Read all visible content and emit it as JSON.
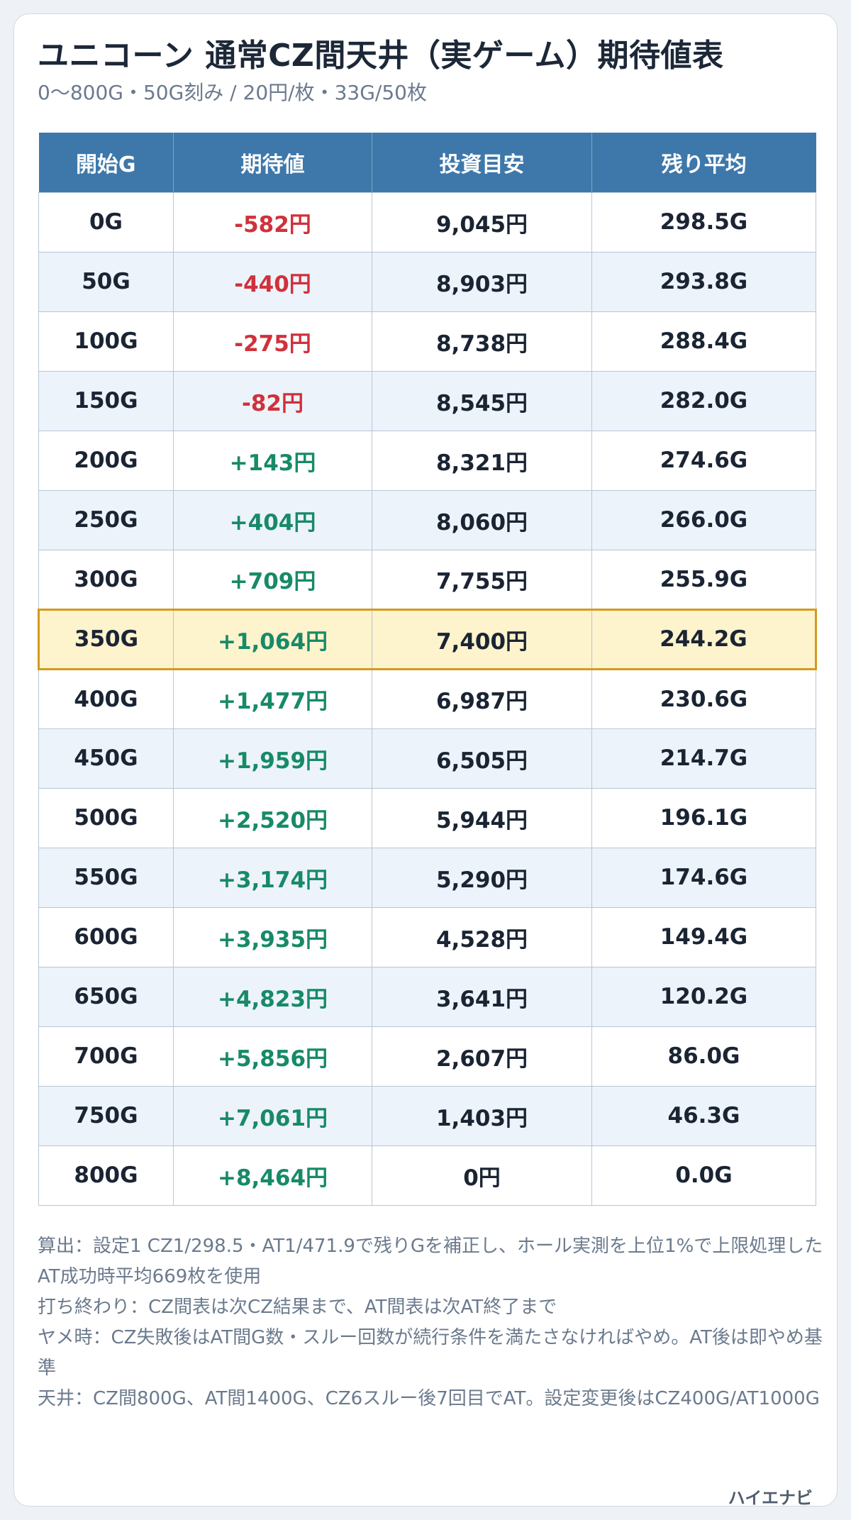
{
  "title": "ユニコーン 通常CZ間天井（実ゲーム）期待値表",
  "subtitle": "0〜800G・50G刻み / 20円/枚・33G/50枚",
  "table": {
    "headers": [
      "開始G",
      "期待値",
      "投資目安",
      "残り平均"
    ],
    "highlight_row": 7,
    "rows": [
      {
        "start": "0G",
        "ev": "-582円",
        "sign": "neg",
        "invest": "9,045円",
        "remain": "298.5G"
      },
      {
        "start": "50G",
        "ev": "-440円",
        "sign": "neg",
        "invest": "8,903円",
        "remain": "293.8G"
      },
      {
        "start": "100G",
        "ev": "-275円",
        "sign": "neg",
        "invest": "8,738円",
        "remain": "288.4G"
      },
      {
        "start": "150G",
        "ev": "-82円",
        "sign": "neg",
        "invest": "8,545円",
        "remain": "282.0G"
      },
      {
        "start": "200G",
        "ev": "+143円",
        "sign": "pos",
        "invest": "8,321円",
        "remain": "274.6G"
      },
      {
        "start": "250G",
        "ev": "+404円",
        "sign": "pos",
        "invest": "8,060円",
        "remain": "266.0G"
      },
      {
        "start": "300G",
        "ev": "+709円",
        "sign": "pos",
        "invest": "7,755円",
        "remain": "255.9G"
      },
      {
        "start": "350G",
        "ev": "+1,064円",
        "sign": "pos",
        "invest": "7,400円",
        "remain": "244.2G"
      },
      {
        "start": "400G",
        "ev": "+1,477円",
        "sign": "pos",
        "invest": "6,987円",
        "remain": "230.6G"
      },
      {
        "start": "450G",
        "ev": "+1,959円",
        "sign": "pos",
        "invest": "6,505円",
        "remain": "214.7G"
      },
      {
        "start": "500G",
        "ev": "+2,520円",
        "sign": "pos",
        "invest": "5,944円",
        "remain": "196.1G"
      },
      {
        "start": "550G",
        "ev": "+3,174円",
        "sign": "pos",
        "invest": "5,290円",
        "remain": "174.6G"
      },
      {
        "start": "600G",
        "ev": "+3,935円",
        "sign": "pos",
        "invest": "4,528円",
        "remain": "149.4G"
      },
      {
        "start": "650G",
        "ev": "+4,823円",
        "sign": "pos",
        "invest": "3,641円",
        "remain": "120.2G"
      },
      {
        "start": "700G",
        "ev": "+5,856円",
        "sign": "pos",
        "invest": "2,607円",
        "remain": "86.0G"
      },
      {
        "start": "750G",
        "ev": "+7,061円",
        "sign": "pos",
        "invest": "1,403円",
        "remain": "46.3G"
      },
      {
        "start": "800G",
        "ev": "+8,464円",
        "sign": "pos",
        "invest": "0円",
        "remain": "0.0G"
      }
    ]
  },
  "notes": [
    "算出：設定1 CZ1/298.5・AT1/471.9で残りGを補正し、ホール実測を上位1%で上限処理したAT成功時平均669枚を使用",
    "打ち終わり：CZ間表は次CZ結果まで、AT間表は次AT終了まで",
    "ヤメ時：CZ失敗後はAT間G数・スルー回数が続行条件を満たさなければやめ。AT後は即やめ基準",
    "天井：CZ間800G、AT間1400G、CZ6スルー後7回目でAT。設定変更後はCZ400G/AT1000G"
  ],
  "brand": "ハイエナビ",
  "colors": {
    "header_bg": "#3e78aa",
    "negative": "#d0313b",
    "positive": "#178a68",
    "highlight_bg": "#fdf3cc",
    "highlight_border": "#d49a1e"
  }
}
